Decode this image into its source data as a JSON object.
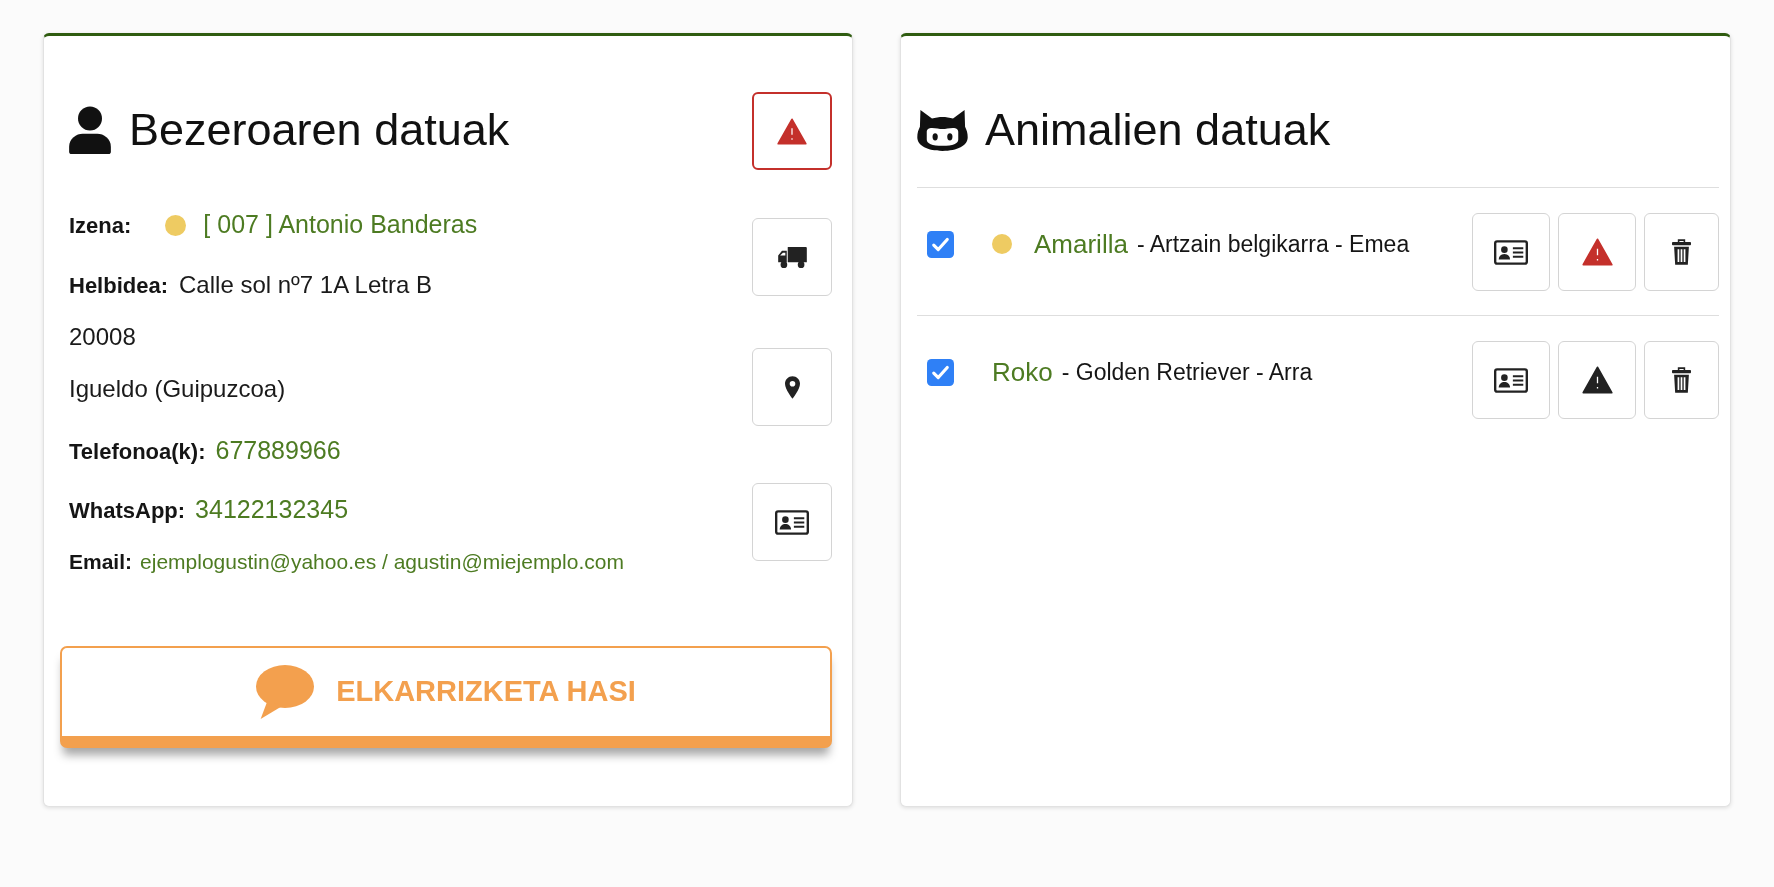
{
  "client": {
    "title": "Bezeroaren datuak",
    "alert": true,
    "name": {
      "label": "Izena:",
      "color": "#eecb62",
      "value": "[ 007 ] Antonio Banderas"
    },
    "address": {
      "label": "Helbidea:",
      "lines": [
        "Calle sol nº7 1A Letra B",
        "20008",
        "Igueldo (Guipuzcoa)"
      ]
    },
    "phone": {
      "label": "Telefonoa(k):",
      "value": "677889966"
    },
    "whatsapp": {
      "label": "WhatsApp:",
      "value": "34122132345"
    },
    "email": {
      "label": "Email:",
      "value": "ejemplogustin@yahoo.es / agustin@miejemplo.com"
    },
    "chat_button": "ELKARRIZKETA HASI"
  },
  "animals": {
    "title": "Animalien datuak",
    "items": [
      {
        "checked": true,
        "color": "#eecb62",
        "name": "Amarilla",
        "details": "- Artzain belgikarra - Emea",
        "alert": true
      },
      {
        "checked": true,
        "name": "Roko",
        "details": "- Golden Retriever - Arra",
        "alert": false
      }
    ]
  }
}
